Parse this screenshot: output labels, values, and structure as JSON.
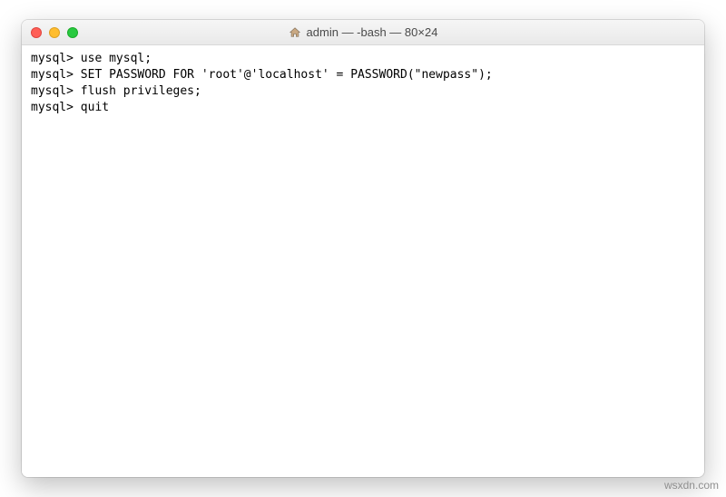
{
  "window": {
    "title": "admin — -bash — 80×24"
  },
  "terminal": {
    "lines": [
      {
        "prompt": "mysql>",
        "cmd": "use mysql;"
      },
      {
        "prompt": "mysql>",
        "cmd": "SET PASSWORD FOR 'root'@'localhost' = PASSWORD(\"newpass\");"
      },
      {
        "prompt": "mysql>",
        "cmd": "flush privileges;"
      },
      {
        "prompt": "mysql>",
        "cmd": "quit"
      }
    ]
  },
  "watermark": "wsxdn.com"
}
